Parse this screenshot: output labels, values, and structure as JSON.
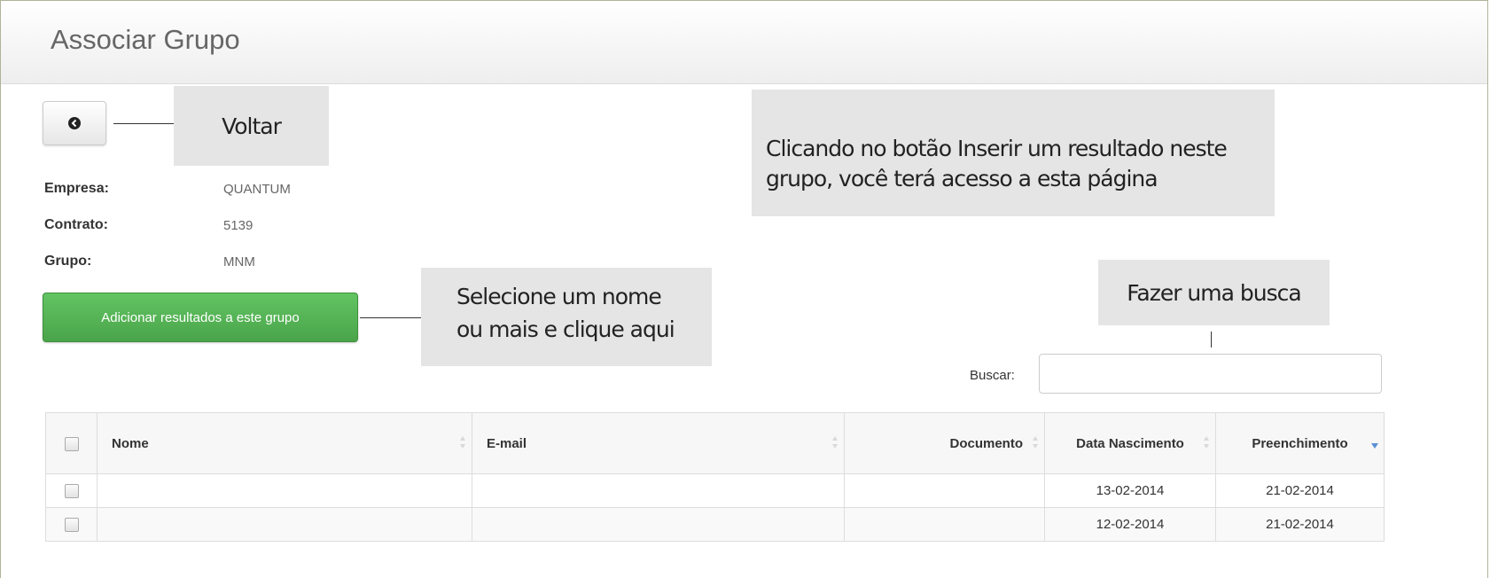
{
  "page": {
    "title": "Associar Grupo"
  },
  "callouts": {
    "back": "Voltar",
    "insert_line1": "Clicando no botão Inserir um resultado neste",
    "insert_line2": "grupo, você terá acesso a esta página",
    "select_line1": "Selecione um nome",
    "select_line2": "ou mais e clique aqui",
    "search": "Fazer uma busca"
  },
  "info": [
    {
      "label": "Empresa:",
      "value": "QUANTUM"
    },
    {
      "label": "Contrato:",
      "value": "5139"
    },
    {
      "label": "Grupo:",
      "value": "MNM"
    }
  ],
  "actions": {
    "add_button": "Adicionar resultados a este grupo",
    "back_icon": "circle-arrow-left-icon"
  },
  "search": {
    "label": "Buscar:",
    "value": ""
  },
  "table": {
    "columns": [
      "",
      "Nome",
      "E-mail",
      "Documento",
      "Data Nascimento",
      "Preenchimento"
    ],
    "sorted_column": "Preenchimento",
    "rows": [
      {
        "nome": "",
        "email": "",
        "documento": "",
        "nascimento": "13-02-2014",
        "preenchimento": "21-02-2014"
      },
      {
        "nome": "",
        "email": "",
        "documento": "",
        "nascimento": "12-02-2014",
        "preenchimento": "21-02-2014"
      }
    ]
  },
  "colors": {
    "accent_green": "#5bb75b",
    "sort_active": "#5b8fd6"
  }
}
